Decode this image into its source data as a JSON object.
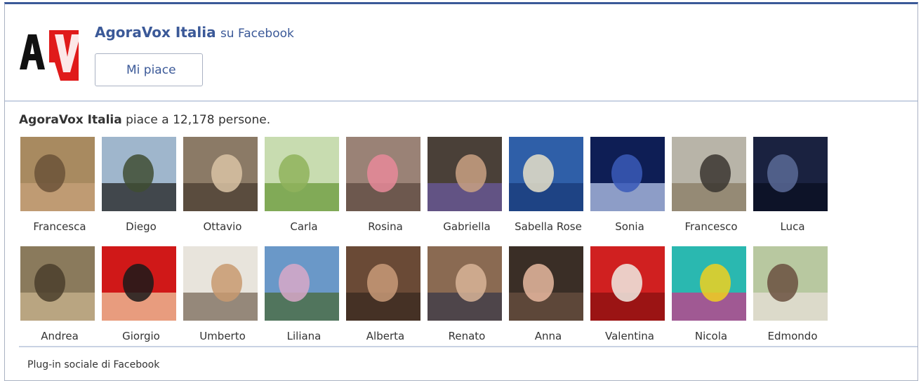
{
  "header": {
    "page_name": "AgoraVox Italia",
    "on_text": "su Facebook",
    "like_label": "Mi piace",
    "logo_icon": "agoravox-logo-icon"
  },
  "fans": {
    "count_page_name": "AgoraVox Italia",
    "count_text": "piace a 12,178 persone.",
    "rows": [
      [
        {
          "name": "Francesca",
          "colors": [
            "#a88a60",
            "#6b5238",
            "#c7a07a"
          ]
        },
        {
          "name": "Diego",
          "colors": [
            "#9fb6cc",
            "#3f4e33",
            "#222222"
          ]
        },
        {
          "name": "Ottavio",
          "colors": [
            "#8b7a66",
            "#d9c3a5",
            "#4a3e32"
          ]
        },
        {
          "name": "Carla",
          "colors": [
            "#c8dcb0",
            "#8fb35c",
            "#6a9a3a"
          ]
        },
        {
          "name": "Rosina",
          "colors": [
            "#9a8276",
            "#e78a9a",
            "#5e4a42"
          ]
        },
        {
          "name": "Gabriella",
          "colors": [
            "#4a4038",
            "#c9a183",
            "#6b5a9e"
          ]
        },
        {
          "name": "Sabella Rose",
          "colors": [
            "#2f5fa8",
            "#e8e0c8",
            "#1a3a78"
          ]
        },
        {
          "name": "Sonia",
          "colors": [
            "#0e1e55",
            "#3a5ab8",
            "#b8c8ee"
          ]
        },
        {
          "name": "Francesco",
          "colors": [
            "#b8b4a8",
            "#3a3530",
            "#8a7c64"
          ]
        },
        {
          "name": "Luca",
          "colors": [
            "#1a2240",
            "#5a6a96",
            "#0a0f20"
          ]
        }
      ],
      [
        {
          "name": "Andrea",
          "colors": [
            "#8a7a5c",
            "#4a3e2c",
            "#c8b48e"
          ]
        },
        {
          "name": "Giorgio",
          "colors": [
            "#d01818",
            "#1a1a1a",
            "#f0c8a0"
          ]
        },
        {
          "name": "Umberto",
          "colors": [
            "#e8e4dc",
            "#c89a70",
            "#7a6a5a"
          ]
        },
        {
          "name": "Liliana",
          "colors": [
            "#6a98c8",
            "#d8a8c8",
            "#4a6a3a"
          ]
        },
        {
          "name": "Alberta",
          "colors": [
            "#6a4a36",
            "#c89a78",
            "#3a2a20"
          ]
        },
        {
          "name": "Renato",
          "colors": [
            "#8a6a52",
            "#d8b498",
            "#3a3a48"
          ]
        },
        {
          "name": "Anna",
          "colors": [
            "#3a2e26",
            "#e8b8a0",
            "#6a5040"
          ]
        },
        {
          "name": "Valentina",
          "colors": [
            "#d02020",
            "#f0ece4",
            "#8a1010"
          ]
        },
        {
          "name": "Nicola",
          "colors": [
            "#2ab8b0",
            "#f0d020",
            "#c83a8a"
          ]
        },
        {
          "name": "Edmondo",
          "colors": [
            "#b8c8a0",
            "#6a5040",
            "#e8e0d8"
          ]
        }
      ]
    ]
  },
  "footer": {
    "text": "Plug-in sociale di Facebook"
  }
}
